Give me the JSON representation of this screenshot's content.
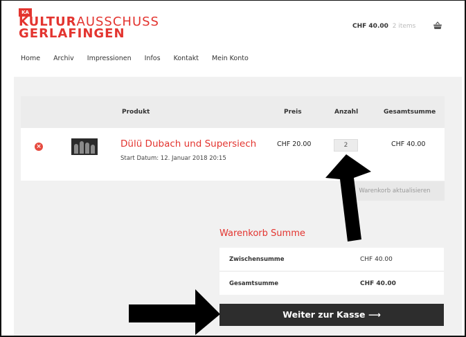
{
  "header": {
    "logo_badge": "KA",
    "logo_bold": "KULTUR",
    "logo_thin": "AUSSCHUSS",
    "logo_line2": "GERLAFINGEN",
    "cart_amount": "CHF 40.00",
    "cart_items": "2 items",
    "basket_icon": "basket-icon"
  },
  "nav": {
    "items": [
      "Home",
      "Archiv",
      "Impressionen",
      "Infos",
      "Kontakt",
      "Mein Konto"
    ]
  },
  "cart_table": {
    "headers": {
      "product": "Produkt",
      "price": "Preis",
      "quantity": "Anzahl",
      "total": "Gesamtsumme"
    },
    "rows": [
      {
        "remove_icon": "remove-icon",
        "remove_glyph": "×",
        "name": "Dülü Dubach und Supersiech",
        "date": "Start Datum: 12. Januar 2018 20:15",
        "price": "CHF 20.00",
        "quantity": "2",
        "subtotal": "CHF 40.00"
      }
    ],
    "update_label": "Warenkorb aktualisieren"
  },
  "totals": {
    "title": "Warenkorb Summe",
    "subtotal_label": "Zwischensumme",
    "subtotal_value": "CHF 40.00",
    "total_label": "Gesamtsumme",
    "total_value": "CHF 40.00"
  },
  "checkout": {
    "label": "Weiter zur Kasse ⟶"
  },
  "colors": {
    "brand_red": "#e3342f",
    "dark_button": "#2d2d2d",
    "panel_grey": "#f1f1f1",
    "annotation_arrow": "#000000"
  }
}
